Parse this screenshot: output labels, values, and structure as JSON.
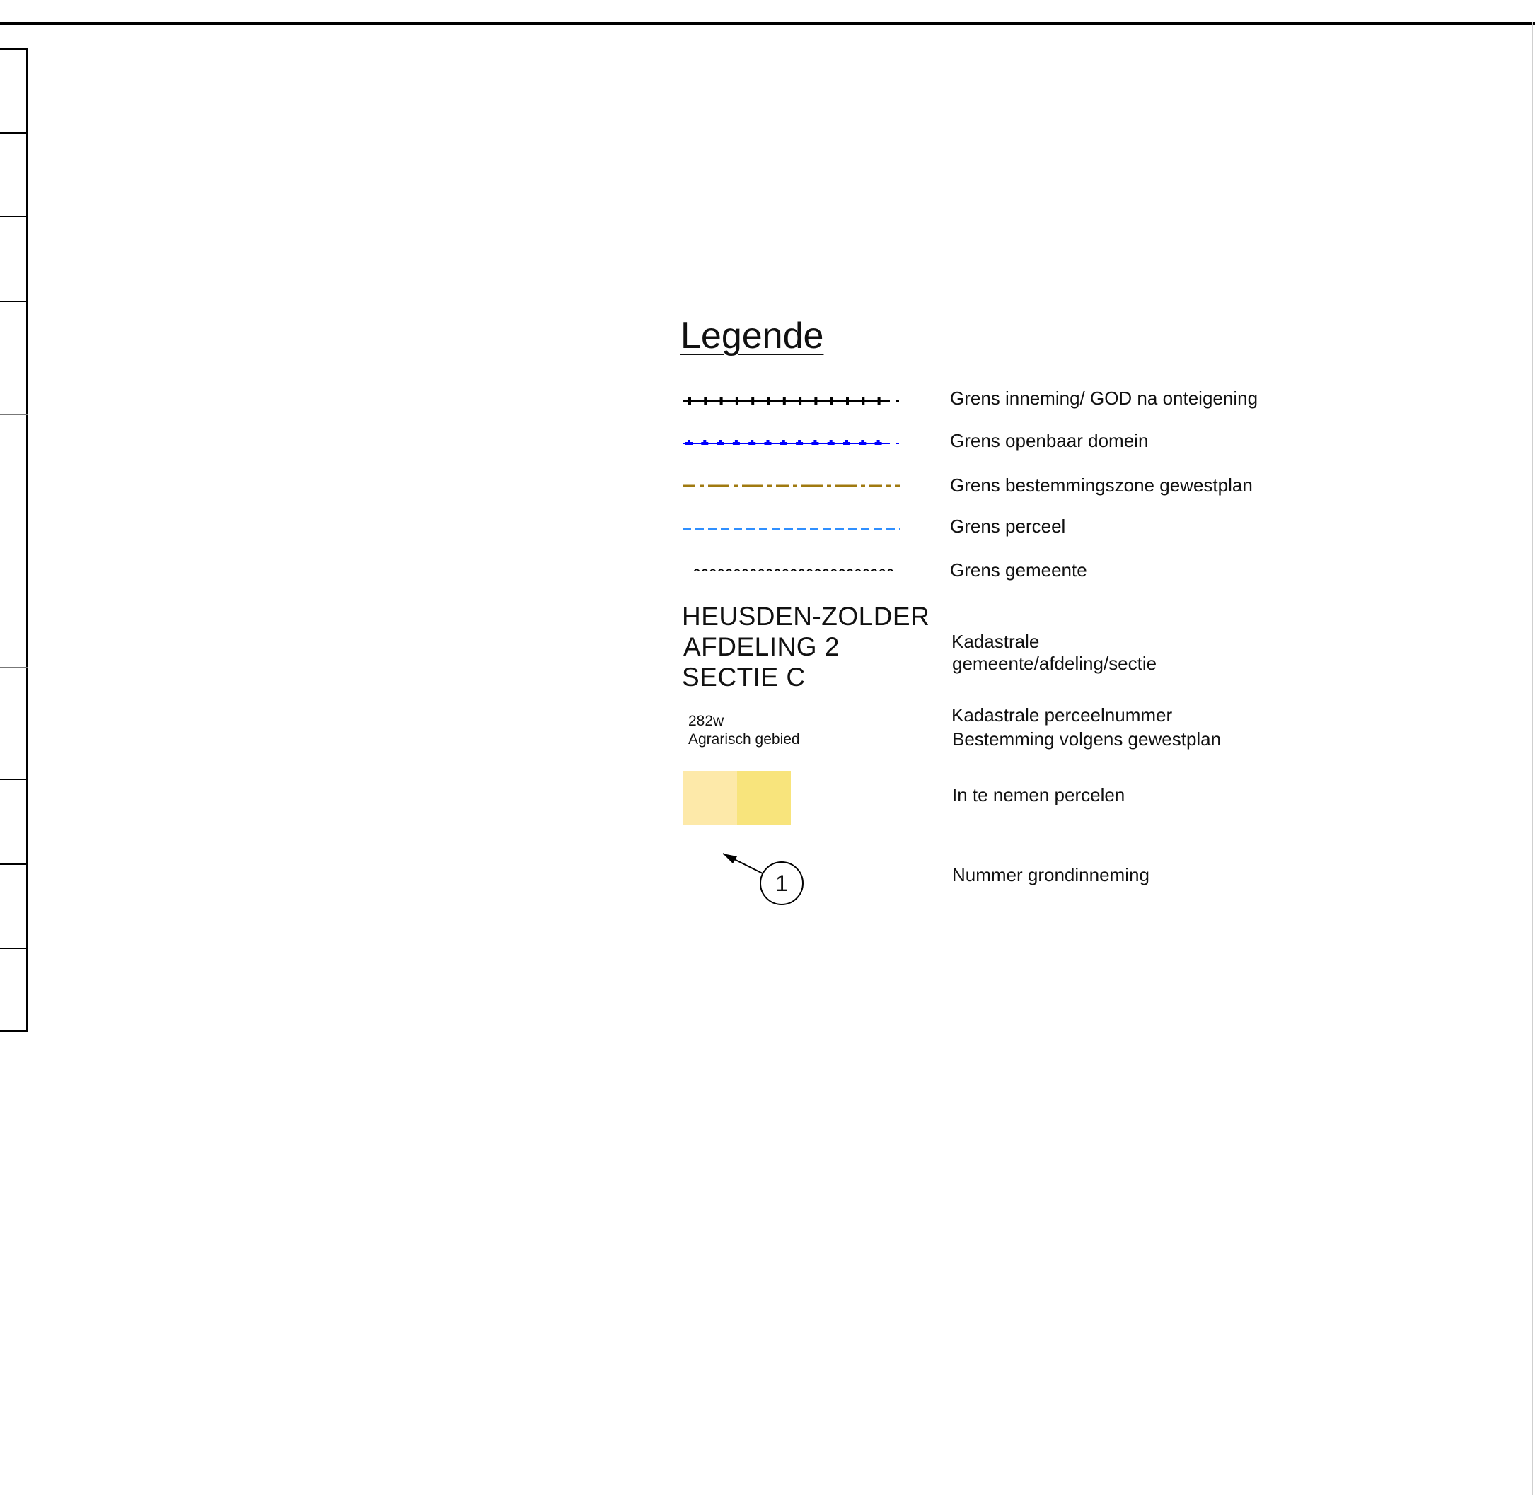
{
  "legend": {
    "title": "Legende",
    "items": [
      {
        "symbol": "plus-line",
        "color": "#000000",
        "label": "Grens inneming/ GOD na onteigening"
      },
      {
        "symbol": "blue-dashed",
        "color": "#0000ff",
        "label": "Grens openbaar domein"
      },
      {
        "symbol": "dash-dot",
        "color": "#a07a10",
        "label": "Grens bestemmingszone gewestplan"
      },
      {
        "symbol": "light-dashed",
        "color": "#2f8fff",
        "label": "Grens perceel"
      },
      {
        "symbol": "circle-chain",
        "color": "#000000",
        "label": "Grens gemeente"
      }
    ],
    "kadastrale": {
      "sample_lines": [
        "HEUSDEN-ZOLDER",
        "AFDELING 2",
        "SECTIE C"
      ],
      "label_lines": [
        "Kadastrale",
        "gemeente/afdeling/sectie"
      ]
    },
    "perceel": {
      "sample_number": "282w",
      "sample_zone": "Agrarisch gebied",
      "label_lines": [
        "Kadastrale perceelnummer",
        "Bestemming volgens gewestplan"
      ]
    },
    "in_te_nemen": {
      "swatch_colors": [
        "#fde9a9",
        "#f8e47c"
      ],
      "label": "In te nemen percelen"
    },
    "grondinneming": {
      "sample_number": "1",
      "label": "Nummer grondinneming"
    }
  }
}
